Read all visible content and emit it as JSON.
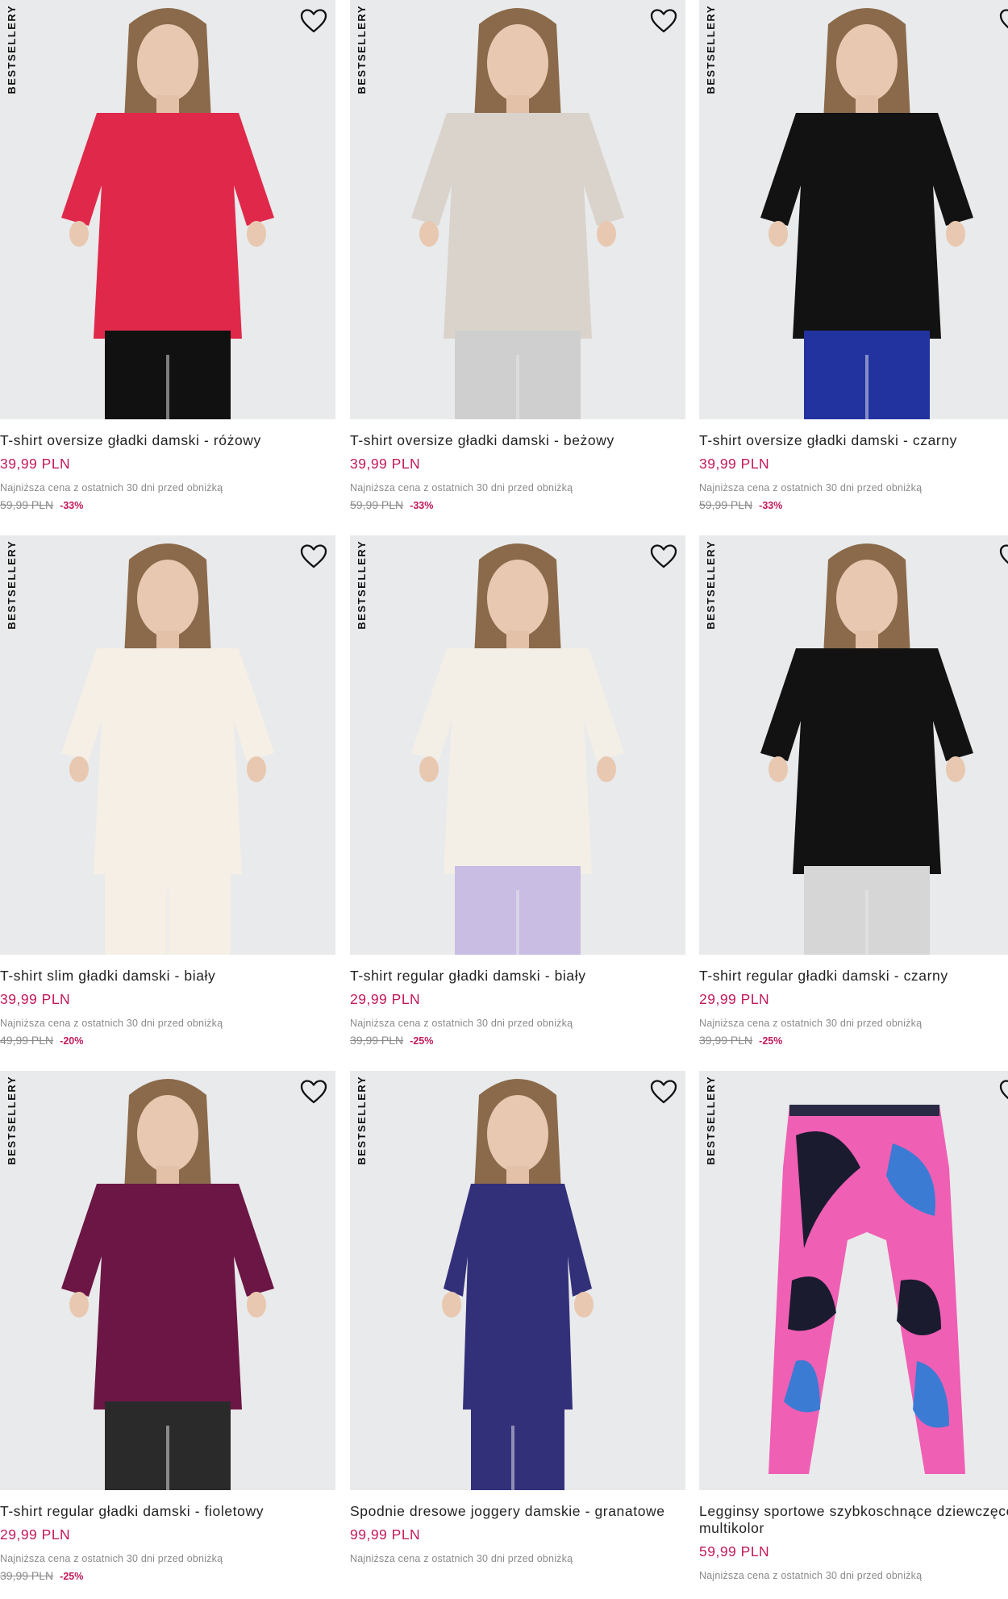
{
  "products": [
    {
      "badge": "BESTSELLERY",
      "title": "T-shirt oversize gładki damski - różowy",
      "price": "39,99 PLN",
      "lowest": "Najniższa cena z ostatnich 30 dni przed obniżką",
      "old_price": "59,99 PLN",
      "discount": "-33%",
      "shirt_color": "#e0284b",
      "bottom_color": "#111111",
      "bg": "#e9eaeb"
    },
    {
      "badge": "BESTSELLERY",
      "title": "T-shirt oversize gładki damski - beżowy",
      "price": "39,99 PLN",
      "lowest": "Najniższa cena z ostatnich 30 dni przed obniżką",
      "old_price": "59,99 PLN",
      "discount": "-33%",
      "shirt_color": "#d9d3cc",
      "bottom_color": "#cfcfcf",
      "bg": "#e9eaeb"
    },
    {
      "badge": "BESTSELLERY",
      "title": "T-shirt oversize gładki damski - czarny",
      "price": "39,99 PLN",
      "lowest": "Najniższa cena z ostatnich 30 dni przed obniżką",
      "old_price": "59,99 PLN",
      "discount": "-33%",
      "shirt_color": "#121212",
      "bottom_color": "#2233a0",
      "bg": "#e9eaeb"
    },
    {
      "badge": "BESTSELLERY",
      "title": "T-shirt slim gładki damski - biały",
      "price": "39,99 PLN",
      "lowest": "Najniższa cena z ostatnich 30 dni przed obniżką",
      "old_price": "49,99 PLN",
      "discount": "-20%",
      "shirt_color": "#f5efe6",
      "bottom_color": "#f5efe6",
      "bg": "#e9eaeb"
    },
    {
      "badge": "BESTSELLERY",
      "title": "T-shirt regular gładki damski - biały",
      "price": "29,99 PLN",
      "lowest": "Najniższa cena z ostatnich 30 dni przed obniżką",
      "old_price": "39,99 PLN",
      "discount": "-25%",
      "shirt_color": "#f3efe7",
      "bottom_color": "#c9bde3",
      "bg": "#e9eaeb"
    },
    {
      "badge": "BESTSELLERY",
      "title": "T-shirt regular gładki damski - czarny",
      "price": "29,99 PLN",
      "lowest": "Najniższa cena z ostatnich 30 dni przed obniżką",
      "old_price": "39,99 PLN",
      "discount": "-25%",
      "shirt_color": "#121212",
      "bottom_color": "#d6d6d6",
      "bg": "#e9eaeb"
    },
    {
      "badge": "BESTSELLERY",
      "title": "T-shirt regular gładki damski - fioletowy",
      "price": "29,99 PLN",
      "lowest": "Najniższa cena z ostatnich 30 dni przed obniżką",
      "old_price": "39,99 PLN",
      "discount": "-25%",
      "shirt_color": "#6b1644",
      "bottom_color": "#2a2a2a",
      "bg": "#e9eaeb"
    },
    {
      "badge": "BESTSELLERY",
      "title": "Spodnie dresowe joggery damskie - granatowe",
      "price": "99,99 PLN",
      "lowest": "Najniższa cena z ostatnich 30 dni przed obniżką",
      "old_price": "",
      "discount": "",
      "shirt_color": "#33307a",
      "bottom_color": "#33307a",
      "bg": "#e9eaeb"
    },
    {
      "badge": "BESTSELLERY",
      "title": "Legginsy sportowe szybkoschnące dziewczęce - multikolor",
      "price": "59,99 PLN",
      "lowest": "Najniższa cena z ostatnich 30 dni przed obniżką",
      "old_price": "",
      "discount": "",
      "shirt_color": "#ef5fb4",
      "bottom_color": "#3b7bd4",
      "bg": "#e9eaeb"
    }
  ]
}
